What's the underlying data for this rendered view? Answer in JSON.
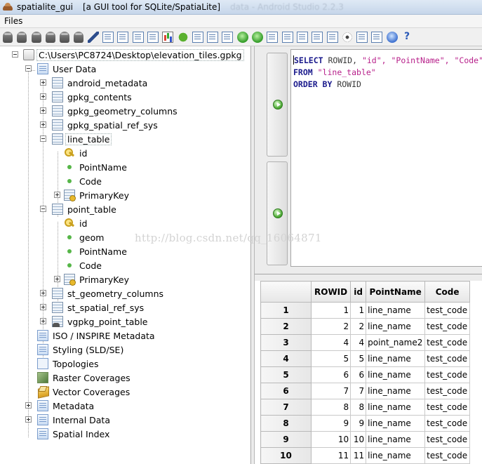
{
  "window": {
    "title": "spatialite_gui",
    "subtitle": "[a GUI tool for SQLite/SpatiaLite]",
    "ghost_text": "data - Android Studio 2.2.3"
  },
  "menu": {
    "files_label": "Files"
  },
  "toolbar": {
    "icons": [
      "db-connect-icon",
      "db-disconnect-icon",
      "db-new-icon",
      "db-memory-icon",
      "db-save-icon",
      "db-export-icon",
      "pen-icon",
      "sql-script-icon",
      "sql-load-icon",
      "vector-load-icon",
      "shapefile-icon",
      "chart-icon",
      "bug-icon",
      "tag-icon",
      "doc-icon",
      "wfs-icon",
      "green-go-icon",
      "green-network-icon",
      "dbf-icon",
      "xl-icon",
      "table-icon",
      "xml-icon",
      "svg-icon",
      "eye-icon",
      "color-icon",
      "list-icon",
      "connect-icon",
      "help-icon"
    ]
  },
  "tree": {
    "root": "C:\\Users\\PC8724\\Desktop\\elevation_tiles.gpkg",
    "user_data": "User Data",
    "tables": {
      "android_metadata": "android_metadata",
      "gpkg_contents": "gpkg_contents",
      "gpkg_geometry_columns": "gpkg_geometry_columns",
      "gpkg_spatial_ref_sys": "gpkg_spatial_ref_sys",
      "line_table": "line_table",
      "point_table": "point_table",
      "st_geometry_columns": "st_geometry_columns",
      "st_spatial_ref_sys": "st_spatial_ref_sys",
      "vgpkg_point_table": "vgpkg_point_table"
    },
    "line_table_cols": {
      "id": "id",
      "pointname": "PointName",
      "code": "Code",
      "pk": "PrimaryKey"
    },
    "point_table_cols": {
      "id": "id",
      "geom": "geom",
      "pointname": "PointName",
      "code": "Code",
      "pk": "PrimaryKey"
    },
    "sections": {
      "iso": "ISO / INSPIRE Metadata",
      "styling": "Styling (SLD/SE)",
      "topologies": "Topologies",
      "raster": "Raster Coverages",
      "vector": "Vector Coverages",
      "metadata": "Metadata",
      "internal": "Internal Data",
      "spatial_index": "Spatial Index"
    }
  },
  "sql": {
    "kw_select": "SELECT",
    "select_rest_1": " ROWID, ",
    "select_rest_2": "\"id\", \"PointName\", \"Code\"",
    "kw_from": "FROM",
    "from_rest": " \"line_table\"",
    "kw_order": "ORDER BY",
    "order_rest": " ROWID"
  },
  "watermark": "http://blog.csdn.net/qq_16064871",
  "results": {
    "columns": [
      "ROWID",
      "id",
      "PointName",
      "Code"
    ],
    "rows": [
      {
        "n": "1",
        "rowid": "1",
        "id": "1",
        "pointname": "line_name",
        "code": "test_code"
      },
      {
        "n": "2",
        "rowid": "2",
        "id": "2",
        "pointname": "line_name",
        "code": "test_code"
      },
      {
        "n": "3",
        "rowid": "4",
        "id": "4",
        "pointname": "point_name2",
        "code": "test_code"
      },
      {
        "n": "4",
        "rowid": "5",
        "id": "5",
        "pointname": "line_name",
        "code": "test_code"
      },
      {
        "n": "5",
        "rowid": "6",
        "id": "6",
        "pointname": "line_name",
        "code": "test_code"
      },
      {
        "n": "6",
        "rowid": "7",
        "id": "7",
        "pointname": "line_name",
        "code": "test_code"
      },
      {
        "n": "7",
        "rowid": "8",
        "id": "8",
        "pointname": "line_name",
        "code": "test_code"
      },
      {
        "n": "8",
        "rowid": "9",
        "id": "9",
        "pointname": "line_name",
        "code": "test_code"
      },
      {
        "n": "9",
        "rowid": "10",
        "id": "10",
        "pointname": "line_name",
        "code": "test_code"
      },
      {
        "n": "10",
        "rowid": "11",
        "id": "11",
        "pointname": "line_name",
        "code": "test_code"
      }
    ]
  }
}
